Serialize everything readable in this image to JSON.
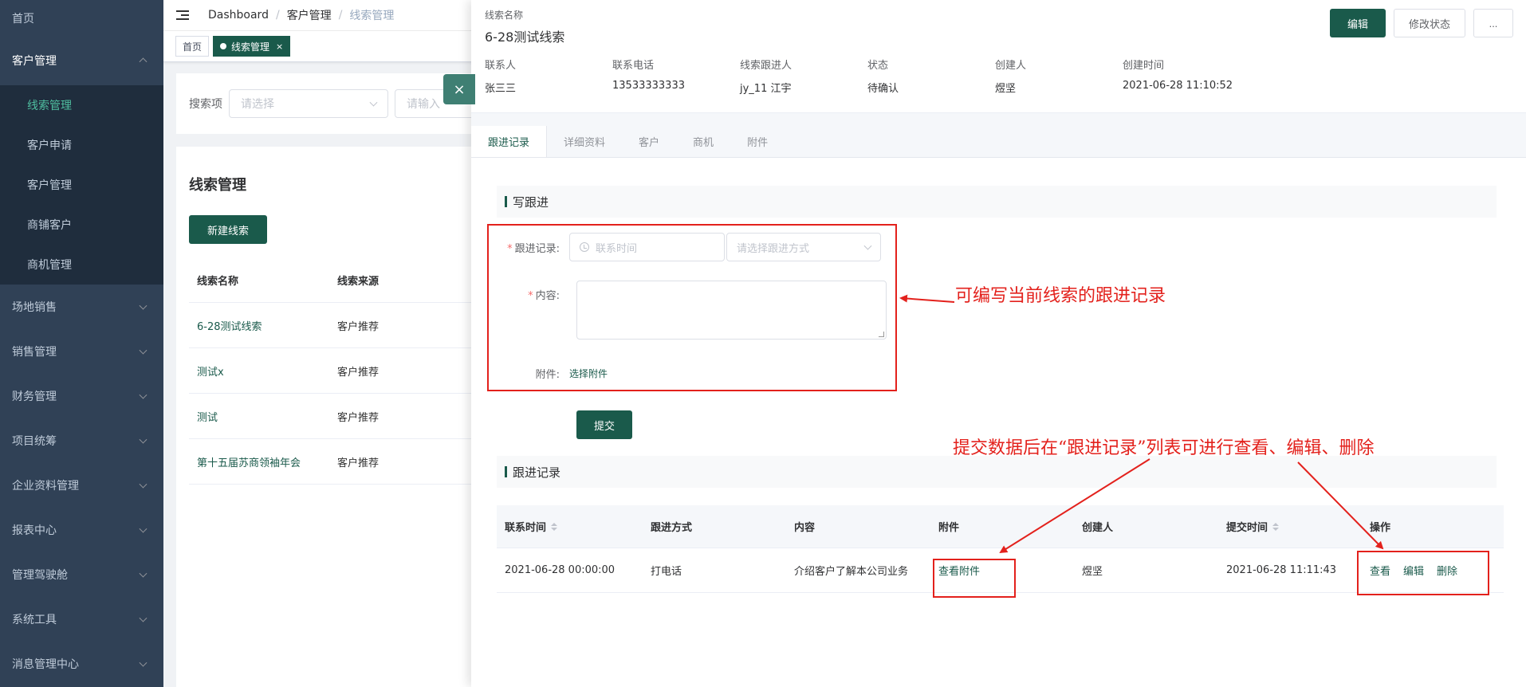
{
  "sidebar": {
    "home": "首页",
    "customer_mgmt": "客户管理",
    "sub_items": [
      "线索管理",
      "客户申请",
      "客户管理",
      "商铺客户",
      "商机管理"
    ],
    "other_items": [
      "场地销售",
      "销售管理",
      "财务管理",
      "项目统筹",
      "企业资料管理",
      "报表中心",
      "管理驾驶舱",
      "系统工具",
      "消息管理中心"
    ]
  },
  "navbar": {
    "breadcrumb": [
      "Dashboard",
      "客户管理",
      "线索管理"
    ]
  },
  "tags": {
    "home": "首页",
    "active": "线索管理",
    "close": "×"
  },
  "search": {
    "label": "搜索项",
    "select_placeholder": "请选择",
    "input_placeholder": "请输入"
  },
  "list": {
    "title": "线索管理",
    "new_button": "新建线索",
    "columns": [
      "线索名称",
      "线索来源"
    ],
    "rows": [
      {
        "name": "6-28测试线索",
        "source": "客户推荐"
      },
      {
        "name": "测试x",
        "source": "客户推荐"
      },
      {
        "name": "测试",
        "source": "客户推荐"
      },
      {
        "name": "第十五届苏商领袖年会",
        "source": "客户推荐"
      }
    ]
  },
  "drawer": {
    "close": "×",
    "name_label": "线索名称",
    "name": "6-28测试线索",
    "edit_button": "编辑",
    "status_button": "修改状态",
    "more_button": "...",
    "info": [
      {
        "k": "联系人",
        "v": "张三三"
      },
      {
        "k": "联系电话",
        "v": "13533333333"
      },
      {
        "k": "线索跟进人",
        "v": "jy_11 江宇"
      },
      {
        "k": "状态",
        "v": "待确认"
      },
      {
        "k": "创建人",
        "v": "煜坚"
      },
      {
        "k": "创建时间",
        "v": "2021-06-28 11:10:52"
      }
    ],
    "tabs": [
      "跟进记录",
      "详细资料",
      "客户",
      "商机",
      "附件"
    ],
    "write_section": "写跟进",
    "form": {
      "record_label": "跟进记录:",
      "time_placeholder": "联系时间",
      "method_placeholder": "请选择跟进方式",
      "content_label": "内容:",
      "attach_label": "附件:",
      "attach_link": "选择附件",
      "submit": "提交"
    },
    "records_section": "跟进记录",
    "records_table": {
      "columns": [
        "联系时间",
        "跟进方式",
        "内容",
        "附件",
        "创建人",
        "提交时间",
        "操作"
      ],
      "row": {
        "time": "2021-06-28 00:00:00",
        "method": "打电话",
        "content": "介绍客户了解本公司业务",
        "attachment": "查看附件",
        "creator": "煜坚",
        "submitted": "2021-06-28 11:11:43",
        "actions": [
          "查看",
          "编辑",
          "删除"
        ]
      }
    }
  },
  "annotations": {
    "form_note": "可编写当前线索的跟进记录",
    "list_note": "提交数据后在“跟进记录”列表可进行查看、编辑、删除"
  },
  "colors": {
    "primary": "#1a5a4b",
    "sidebar_bg": "#304156",
    "annotation": "#e3211c"
  }
}
